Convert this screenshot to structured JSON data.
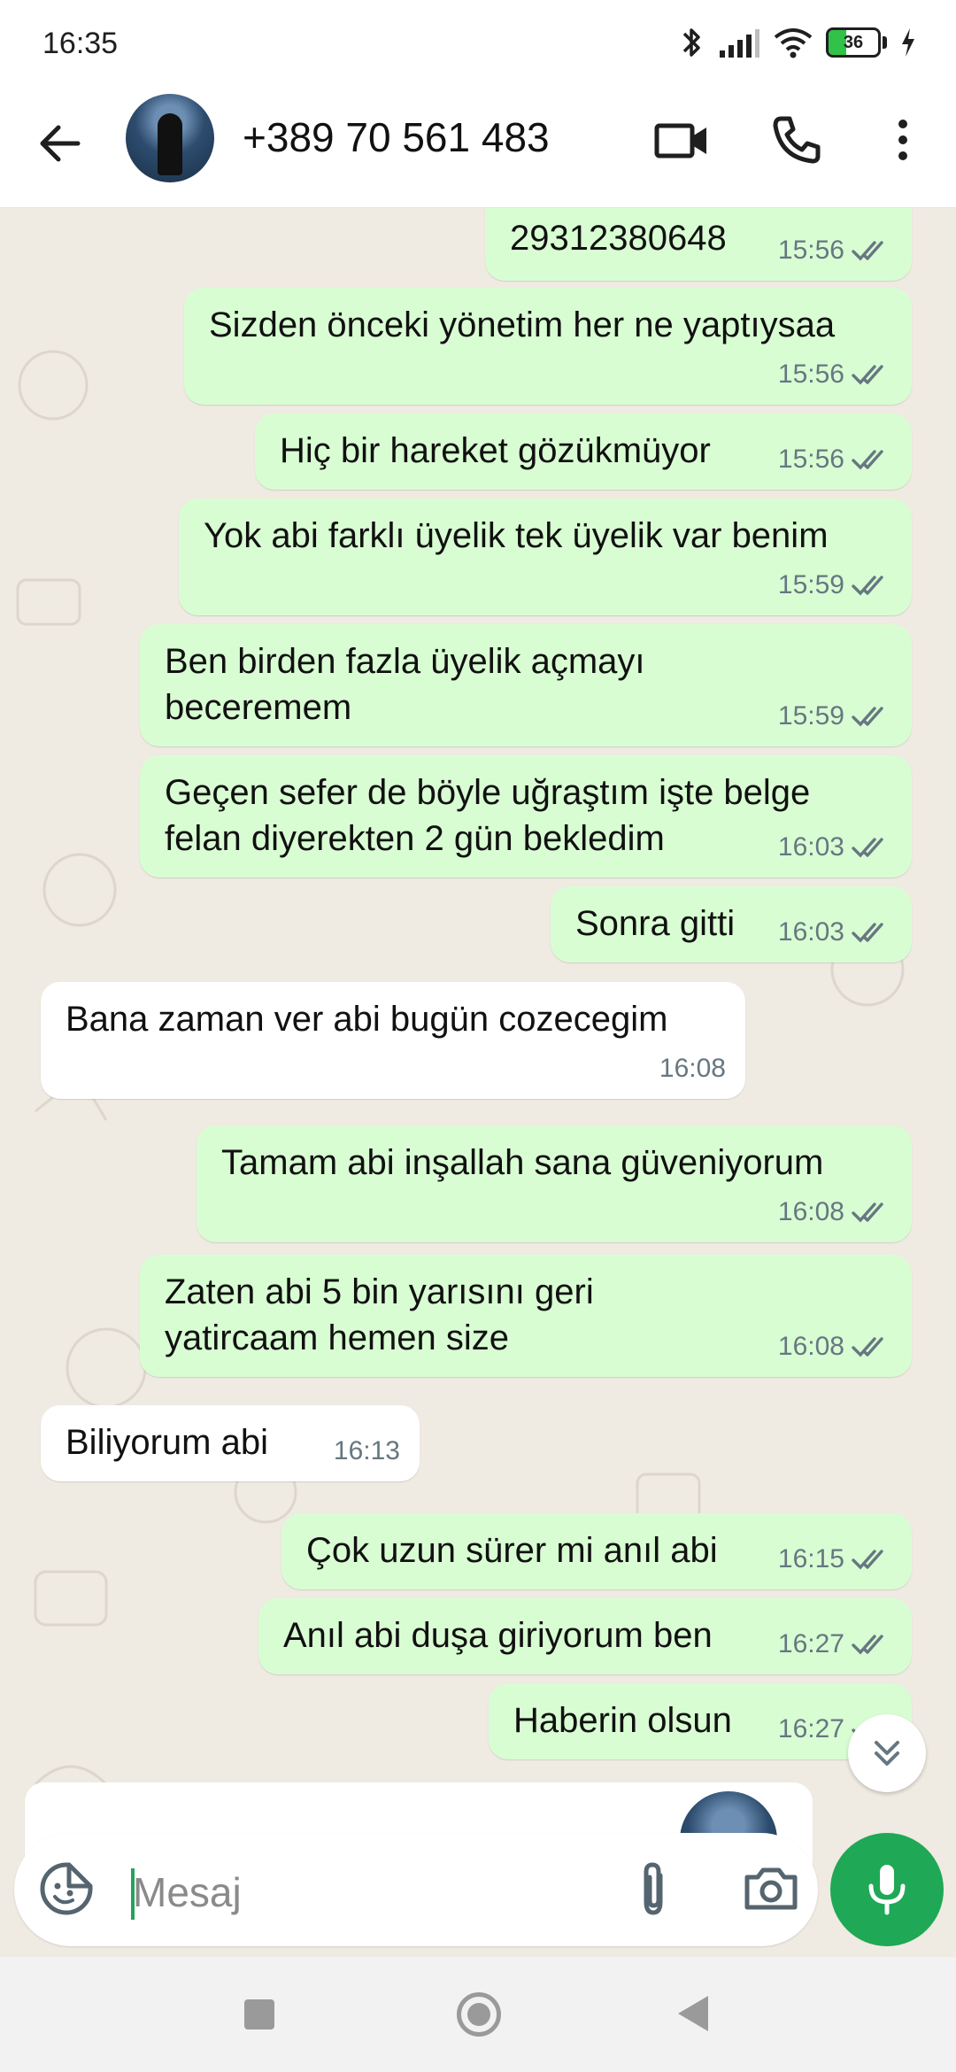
{
  "status_bar": {
    "time": "16:35",
    "battery_level": "36",
    "icons": [
      "bluetooth-icon",
      "signal-icon",
      "wifi-icon",
      "battery-icon",
      "charging-icon"
    ]
  },
  "header": {
    "contact_name": "+389 70 561 483",
    "icons": [
      "back-arrow-icon",
      "video-call-icon",
      "phone-call-icon",
      "more-options-icon"
    ]
  },
  "messages": [
    {
      "dir": "out",
      "text": "29312380648",
      "time": "15:56",
      "read": true
    },
    {
      "dir": "out",
      "text": "Sizden önceki yönetim her ne yaptıysaa",
      "time": "15:56",
      "read": true
    },
    {
      "dir": "out",
      "text": "Hiç bir hareket gözükmüyor",
      "time": "15:56",
      "read": true
    },
    {
      "dir": "out",
      "text": "Yok abi farklı üyelik tek üyelik var benim",
      "time": "15:59",
      "read": true
    },
    {
      "dir": "out",
      "text": "Ben birden fazla üyelik açmayı beceremem",
      "time": "15:59",
      "read": true
    },
    {
      "dir": "out",
      "text": "Geçen sefer de böyle uğraştım işte belge felan diyerekten 2 gün bekledim",
      "time": "16:03",
      "read": true
    },
    {
      "dir": "out",
      "text": "Sonra gitti",
      "time": "16:03",
      "read": true
    },
    {
      "dir": "in",
      "text": "Bana zaman ver abi bugün cozecegim",
      "time": "16:08"
    },
    {
      "dir": "out",
      "text": "Tamam abi inşallah sana güveniyorum",
      "time": "16:08",
      "read": true
    },
    {
      "dir": "out",
      "text": "Zaten abi 5 bin yarısını geri yatircaam hemen size",
      "time": "16:08",
      "read": true
    },
    {
      "dir": "in",
      "text": "Biliyorum abi",
      "time": "16:13"
    },
    {
      "dir": "out",
      "text": "Çok uzun sürer mi anıl abi",
      "time": "16:15",
      "read": true
    },
    {
      "dir": "out",
      "text": "Anıl abi duşa giriyorum ben",
      "time": "16:27",
      "read": true
    },
    {
      "dir": "out",
      "text": "Haberin olsun",
      "time": "16:27",
      "read": true
    }
  ],
  "composer": {
    "placeholder": "Mesaj"
  },
  "colors": {
    "outgoing_bubble": "#d9fdd3",
    "incoming_bubble": "#ffffff",
    "chat_background": "#efeae2",
    "accent_green": "#1fa855",
    "read_ticks": "#667781"
  }
}
